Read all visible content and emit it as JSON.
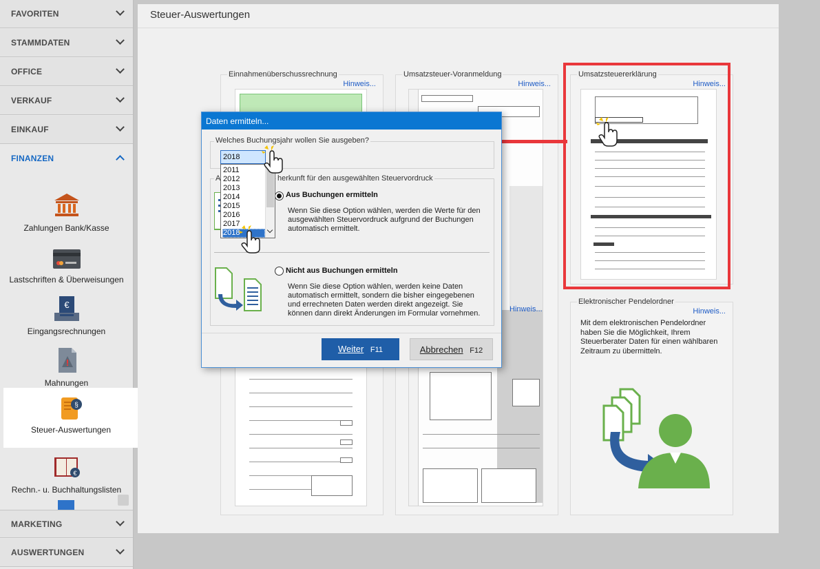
{
  "sidebar": {
    "sections_top": [
      {
        "label": "FAVORITEN"
      },
      {
        "label": "STAMMDATEN"
      },
      {
        "label": "OFFICE"
      },
      {
        "label": "VERKAUF"
      },
      {
        "label": "EINKAUF"
      }
    ],
    "open_section": "FINANZEN",
    "items": [
      {
        "label": "Zahlungen Bank/Kasse",
        "icon": "bank-icon"
      },
      {
        "label": "Lastschriften & Überweisungen",
        "icon": "credit-card-icon"
      },
      {
        "label": "Eingangsrechnungen",
        "icon": "incoming-invoice-icon"
      },
      {
        "label": "Mahnungen",
        "icon": "dunning-warning-icon"
      },
      {
        "label": "Steuer-Auswertungen",
        "icon": "tax-scroll-icon",
        "active": true
      },
      {
        "label": "Rechn.- u. Buchhaltungslisten",
        "icon": "ledger-book-icon"
      }
    ],
    "sections_bottom": [
      {
        "label": "MARKETING"
      },
      {
        "label": "AUSWERTUNGEN"
      }
    ]
  },
  "page": {
    "title": "Steuer-Auswertungen"
  },
  "cards": [
    {
      "title": "Einnahmenüberschussrechnung",
      "hint": "Hinweis..."
    },
    {
      "title": "Umsatzsteuer-Voranmeldung",
      "hint": "Hinweis..."
    },
    {
      "title": "Umsatzsteuererklärung",
      "hint": "Hinweis..."
    },
    {
      "title": "",
      "hint": ""
    },
    {
      "title": "",
      "hint": "Hinweis..."
    },
    {
      "title": "Elektronischer Pendelordner",
      "hint": "Hinweis...",
      "description": "Mit dem elektronischen Pendelordner haben Sie die Möglichkeit, Ihrem Steuerberater Daten für einen wählbaren Zeitraum zu übermitteln."
    }
  ],
  "dialog": {
    "title": "Daten ermitteln...",
    "group1_label": "Welches Buchungsjahr wollen Sie ausgeben?",
    "selected_year": "2018",
    "year_options": [
      "2011",
      "2012",
      "2013",
      "2014",
      "2015",
      "2016",
      "2017",
      "2018"
    ],
    "group2_label": "herkunft für den ausgewählten Steuervordruck",
    "group2_label_prefix": "A",
    "option1_label": "Aus Buchungen ermitteln",
    "option1_desc": "Wenn Sie diese Option wählen, werden die Werte für den ausgewählten Steuervordruck aufgrund der Buchungen automatisch ermittelt.",
    "option2_label": "Nicht aus Buchungen ermitteln",
    "option2_desc": "Wenn Sie diese Option wählen, werden keine Daten automatisch ermittelt, sondern die bisher eingegebenen und errechneten Daten werden direkt angezeigt. Sie können dann direkt Änderungen im Formular vornehmen.",
    "btn_next_label": "Weiter",
    "btn_next_key": "F11",
    "btn_cancel_label": "Abbrechen",
    "btn_cancel_key": "F12"
  },
  "colors": {
    "accent": "#1769c4",
    "primary_button": "#1f5ea8",
    "highlight": "#e9373b",
    "titlebar": "#0b77d2",
    "green": "#6ab04c"
  }
}
